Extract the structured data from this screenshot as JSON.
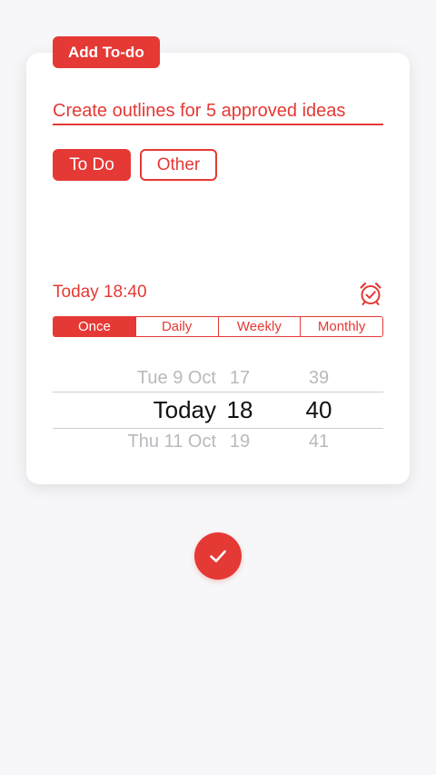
{
  "header": {
    "tag_label": "Add To-do"
  },
  "form": {
    "todo_text": "Create outlines for 5 approved ideas",
    "categories": [
      {
        "label": "To Do",
        "selected": true
      },
      {
        "label": "Other",
        "selected": false
      }
    ]
  },
  "reminder": {
    "label": "Today 18:40",
    "icon": "alarm-check-icon",
    "repeat_options": [
      "Once",
      "Daily",
      "Weekly",
      "Monthly"
    ],
    "repeat_selected": "Once"
  },
  "picker": {
    "date": {
      "prev": "Tue 9 Oct",
      "selected": "Today",
      "next": "Thu 11 Oct"
    },
    "hour": {
      "prev": "17",
      "selected": "18",
      "next": "19"
    },
    "minute": {
      "prev": "39",
      "selected": "40",
      "next": "41"
    }
  },
  "actions": {
    "confirm_icon": "checkmark-icon"
  },
  "colors": {
    "accent": "#e53935",
    "background": "#f7f7f9",
    "card": "#ffffff"
  }
}
